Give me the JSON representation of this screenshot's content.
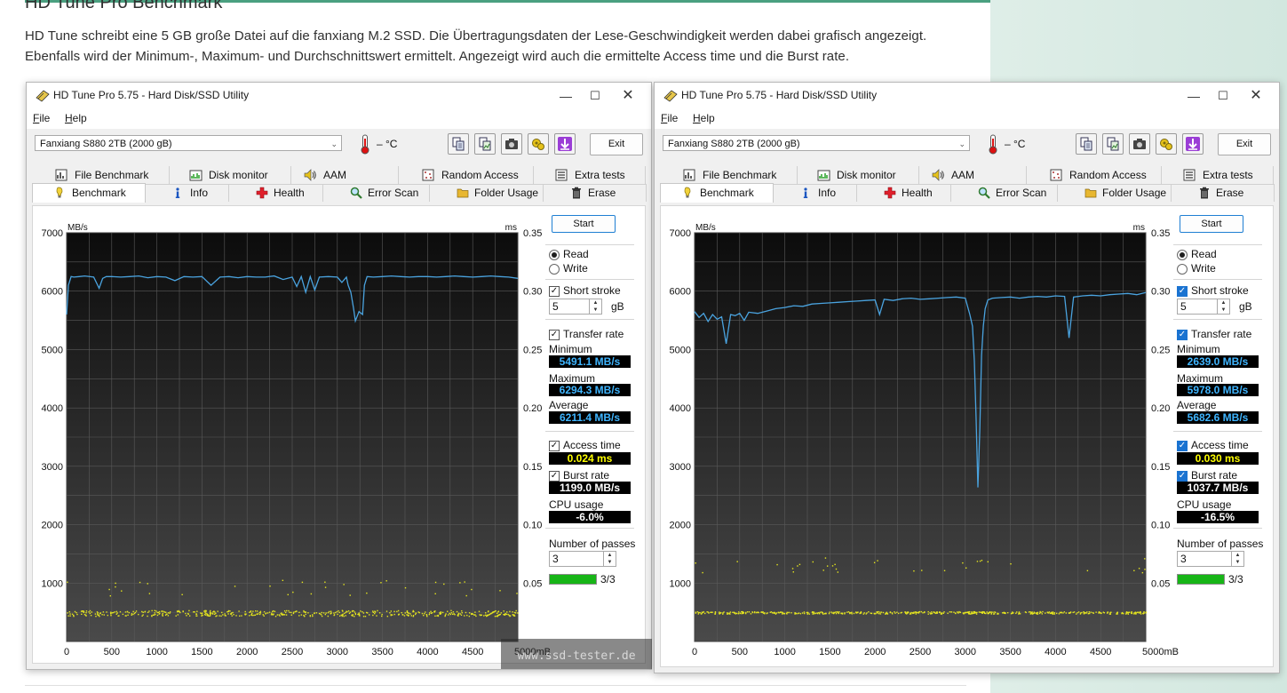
{
  "article": {
    "title": "HD Tune Pro Benchmark",
    "para1": "HD Tune schreibt eine 5 GB große Datei auf die fanxiang M.2 SSD. Die Übertragungsdaten der Lese-Geschwindigkeit werden dabei grafisch angezeigt.",
    "para2": "Ebenfalls wird der Minimum-, Maximum- und Durchschnittswert ermittelt. Angezeigt wird auch die ermittelte Access time und die Burst rate."
  },
  "watermark": "www.ssd-tester.de",
  "colors": {
    "accent": "#4aa080",
    "transfer_line": "#4aa3df",
    "access_dots": "#e6e61e",
    "value_blue": "#3fb5ff",
    "value_yellow": "#ffff00",
    "value_white": "#ffffff",
    "progress": "#17b517"
  },
  "windows": [
    {
      "id": "left",
      "title": "HD Tune Pro 5.75 - Hard Disk/SSD Utility",
      "menu": {
        "file": "File",
        "file_key": "F",
        "file_rest": "ile",
        "help": "Help",
        "help_key": "H",
        "help_rest": "elp"
      },
      "drive": "Fanxiang S880 2TB (2000 gB)",
      "temperature": "– °C",
      "exit_label": "Exit",
      "toolbar_icons": [
        "copy-info-icon",
        "copy-screen-icon",
        "camera-icon",
        "options-icon",
        "download-icon"
      ],
      "tabs_row1": [
        {
          "label": "File Benchmark",
          "icon": "file-benchmark-icon"
        },
        {
          "label": "Disk monitor",
          "icon": "disk-monitor-icon"
        },
        {
          "label": "AAM",
          "icon": "speaker-icon"
        },
        {
          "label": "Random Access",
          "icon": "random-access-icon"
        },
        {
          "label": "Extra tests",
          "icon": "extra-tests-icon"
        }
      ],
      "tabs_row2": [
        {
          "label": "Benchmark",
          "icon": "benchmark-icon",
          "active": true
        },
        {
          "label": "Info",
          "icon": "info-icon"
        },
        {
          "label": "Health",
          "icon": "health-cross-icon"
        },
        {
          "label": "Error Scan",
          "icon": "magnifier-icon"
        },
        {
          "label": "Folder Usage",
          "icon": "folder-icon"
        },
        {
          "label": "Erase",
          "icon": "trash-icon"
        }
      ],
      "panel": {
        "start": "Start",
        "read": "Read",
        "write": "Write",
        "read_selected": true,
        "short_stroke": "Short stroke",
        "short_stroke_checked": true,
        "short_stroke_value": "5",
        "short_stroke_unit": "gB",
        "transfer_rate": "Transfer rate",
        "transfer_rate_checked": true,
        "minimum_label": "Minimum",
        "minimum": "5491.1 MB/s",
        "maximum_label": "Maximum",
        "maximum": "6294.3 MB/s",
        "average_label": "Average",
        "average": "6211.4 MB/s",
        "access_time_label": "Access time",
        "access_time_checked": true,
        "access_time": "0.024 ms",
        "burst_rate_label": "Burst rate",
        "burst_rate_checked": true,
        "burst_rate": "1199.0 MB/s",
        "cpu_usage_label": "CPU usage",
        "cpu_usage": "-6.0%",
        "passes_label": "Number of passes",
        "passes_value": "3",
        "progress_text": "3/3",
        "progress_fraction": 1.0
      },
      "chart_data": {
        "type": "line",
        "title": "",
        "ylabel": "MB/s",
        "y2label": "ms",
        "xunit": "mB",
        "xlim": [
          0,
          5000
        ],
        "ylim": [
          0,
          7000
        ],
        "y2lim": [
          0,
          0.35
        ],
        "x_ticks": [
          "0",
          "500",
          "1000",
          "1500",
          "2000",
          "2500",
          "3000",
          "3500",
          "4000",
          "4500",
          "5000mB"
        ],
        "y_ticks": [
          "7000",
          "6000",
          "5000",
          "4000",
          "3000",
          "2000",
          "1000"
        ],
        "y2_ticks": [
          "0.35",
          "0.30",
          "0.25",
          "0.20",
          "0.15",
          "0.10",
          "0.05"
        ],
        "grid": true,
        "series": [
          {
            "name": "Transfer rate",
            "kind": "line",
            "color": "#4aa3df",
            "x": [
              0,
              20,
              50,
              80,
              140,
              200,
              300,
              360,
              400,
              440,
              500,
              600,
              700,
              800,
              900,
              1000,
              1100,
              1200,
              1300,
              1400,
              1500,
              1600,
              1700,
              1800,
              1900,
              2000,
              2100,
              2200,
              2300,
              2400,
              2500,
              2550,
              2600,
              2650,
              2700,
              2750,
              2800,
              2900,
              3000,
              3050,
              3100,
              3120,
              3150,
              3180,
              3200,
              3240,
              3280,
              3300,
              3330,
              3400,
              3500,
              3600,
              3700,
              3800,
              3900,
              4000,
              4100,
              4200,
              4300,
              4400,
              4500,
              4600,
              4700,
              4800,
              4900,
              5000
            ],
            "y": [
              5600,
              6100,
              6250,
              6240,
              6250,
              6260,
              6240,
              6050,
              6220,
              6250,
              6250,
              6240,
              6250,
              6260,
              6230,
              6250,
              6240,
              6180,
              6250,
              6240,
              6250,
              6100,
              6240,
              6250,
              6230,
              6250,
              6240,
              6240,
              6260,
              6200,
              6240,
              6080,
              6250,
              5980,
              6250,
              6020,
              6240,
              6250,
              6240,
              6150,
              6240,
              6100,
              5980,
              5700,
              5491,
              5650,
              5600,
              6100,
              6250,
              6240,
              6250,
              6260,
              6250,
              6240,
              6250,
              6250,
              6240,
              6250,
              6260,
              6250,
              6240,
              6250,
              6260,
              6250,
              6240,
              6220
            ]
          },
          {
            "name": "Access time",
            "kind": "scatter",
            "color": "#e6e61e",
            "axis": "y2",
            "band": [
              0.022,
              0.027
            ],
            "outliers": 0.045,
            "seed": 11
          }
        ]
      }
    },
    {
      "id": "right",
      "title": "HD Tune Pro 5.75 - Hard Disk/SSD Utility",
      "menu": {
        "file": "File",
        "file_key": "F",
        "file_rest": "ile",
        "help": "Help",
        "help_key": "H",
        "help_rest": "elp"
      },
      "drive": "Fanxiang S880 2TB (2000 gB)",
      "temperature": "– °C",
      "exit_label": "Exit",
      "toolbar_icons": [
        "copy-info-icon",
        "copy-screen-icon",
        "camera-icon",
        "options-icon",
        "download-icon"
      ],
      "tabs_row1": [
        {
          "label": "File Benchmark",
          "icon": "file-benchmark-icon"
        },
        {
          "label": "Disk monitor",
          "icon": "disk-monitor-icon"
        },
        {
          "label": "AAM",
          "icon": "speaker-icon"
        },
        {
          "label": "Random Access",
          "icon": "random-access-icon"
        },
        {
          "label": "Extra tests",
          "icon": "extra-tests-icon"
        }
      ],
      "tabs_row2": [
        {
          "label": "Benchmark",
          "icon": "benchmark-icon",
          "active": true
        },
        {
          "label": "Info",
          "icon": "info-icon"
        },
        {
          "label": "Health",
          "icon": "health-cross-icon"
        },
        {
          "label": "Error Scan",
          "icon": "magnifier-icon"
        },
        {
          "label": "Folder Usage",
          "icon": "folder-icon"
        },
        {
          "label": "Erase",
          "icon": "trash-icon"
        }
      ],
      "panel": {
        "start": "Start",
        "read": "Read",
        "write": "Write",
        "read_selected": true,
        "short_stroke": "Short stroke",
        "short_stroke_checked": true,
        "short_stroke_value": "5",
        "short_stroke_unit": "gB",
        "transfer_rate": "Transfer rate",
        "transfer_rate_checked": true,
        "minimum_label": "Minimum",
        "minimum": "2639.0 MB/s",
        "maximum_label": "Maximum",
        "maximum": "5978.0 MB/s",
        "average_label": "Average",
        "average": "5682.6 MB/s",
        "access_time_label": "Access time",
        "access_time_checked": true,
        "access_time": "0.030 ms",
        "burst_rate_label": "Burst rate",
        "burst_rate_checked": true,
        "burst_rate": "1037.7 MB/s",
        "cpu_usage_label": "CPU usage",
        "cpu_usage": "-16.5%",
        "passes_label": "Number of passes",
        "passes_value": "3",
        "progress_text": "3/3",
        "progress_fraction": 1.0
      },
      "chart_data": {
        "type": "line",
        "title": "",
        "ylabel": "MB/s",
        "y2label": "ms",
        "xunit": "mB",
        "xlim": [
          0,
          5000
        ],
        "ylim": [
          0,
          7000
        ],
        "y2lim": [
          0,
          0.35
        ],
        "x_ticks": [
          "0",
          "500",
          "1000",
          "1500",
          "2000",
          "2500",
          "3000",
          "3500",
          "4000",
          "4500",
          "5000mB"
        ],
        "y_ticks": [
          "7000",
          "6000",
          "5000",
          "4000",
          "3000",
          "2000",
          "1000"
        ],
        "y2_ticks": [
          "0.35",
          "0.30",
          "0.25",
          "0.20",
          "0.15",
          "0.10",
          "0.05"
        ],
        "grid": true,
        "series": [
          {
            "name": "Transfer rate",
            "kind": "line",
            "color": "#4aa3df",
            "x": [
              0,
              50,
              100,
              150,
              200,
              250,
              300,
              350,
              400,
              450,
              500,
              550,
              600,
              700,
              800,
              900,
              1000,
              1100,
              1200,
              1300,
              1400,
              1500,
              1600,
              1700,
              1800,
              1900,
              2000,
              2050,
              2100,
              2200,
              2300,
              2400,
              2500,
              2600,
              2700,
              2800,
              2900,
              3000,
              3050,
              3080,
              3100,
              3120,
              3140,
              3160,
              3180,
              3200,
              3220,
              3250,
              3300,
              3400,
              3500,
              3600,
              3700,
              3800,
              3900,
              4000,
              4100,
              4150,
              4200,
              4300,
              4400,
              4500,
              4600,
              4700,
              4800,
              4900,
              5000
            ],
            "y": [
              5650,
              5550,
              5620,
              5480,
              5600,
              5520,
              5560,
              5100,
              5600,
              5580,
              5620,
              5500,
              5640,
              5620,
              5660,
              5700,
              5720,
              5750,
              5740,
              5780,
              5790,
              5800,
              5810,
              5820,
              5830,
              5840,
              5850,
              5600,
              5860,
              5840,
              5870,
              5880,
              5860,
              5870,
              5880,
              5890,
              5900,
              5880,
              5600,
              5400,
              4800,
              3800,
              2639,
              3600,
              4900,
              5400,
              5700,
              5850,
              5880,
              5890,
              5900,
              5880,
              5900,
              5910,
              5900,
              5920,
              5910,
              5200,
              5900,
              5920,
              5930,
              5920,
              5940,
              5950,
              5960,
              5940,
              5978
            ]
          },
          {
            "name": "Access time",
            "kind": "scatter",
            "color": "#e6e61e",
            "axis": "y2",
            "band": [
              0.024,
              0.026
            ],
            "outliers": 0.065,
            "seed": 29
          }
        ]
      }
    }
  ]
}
